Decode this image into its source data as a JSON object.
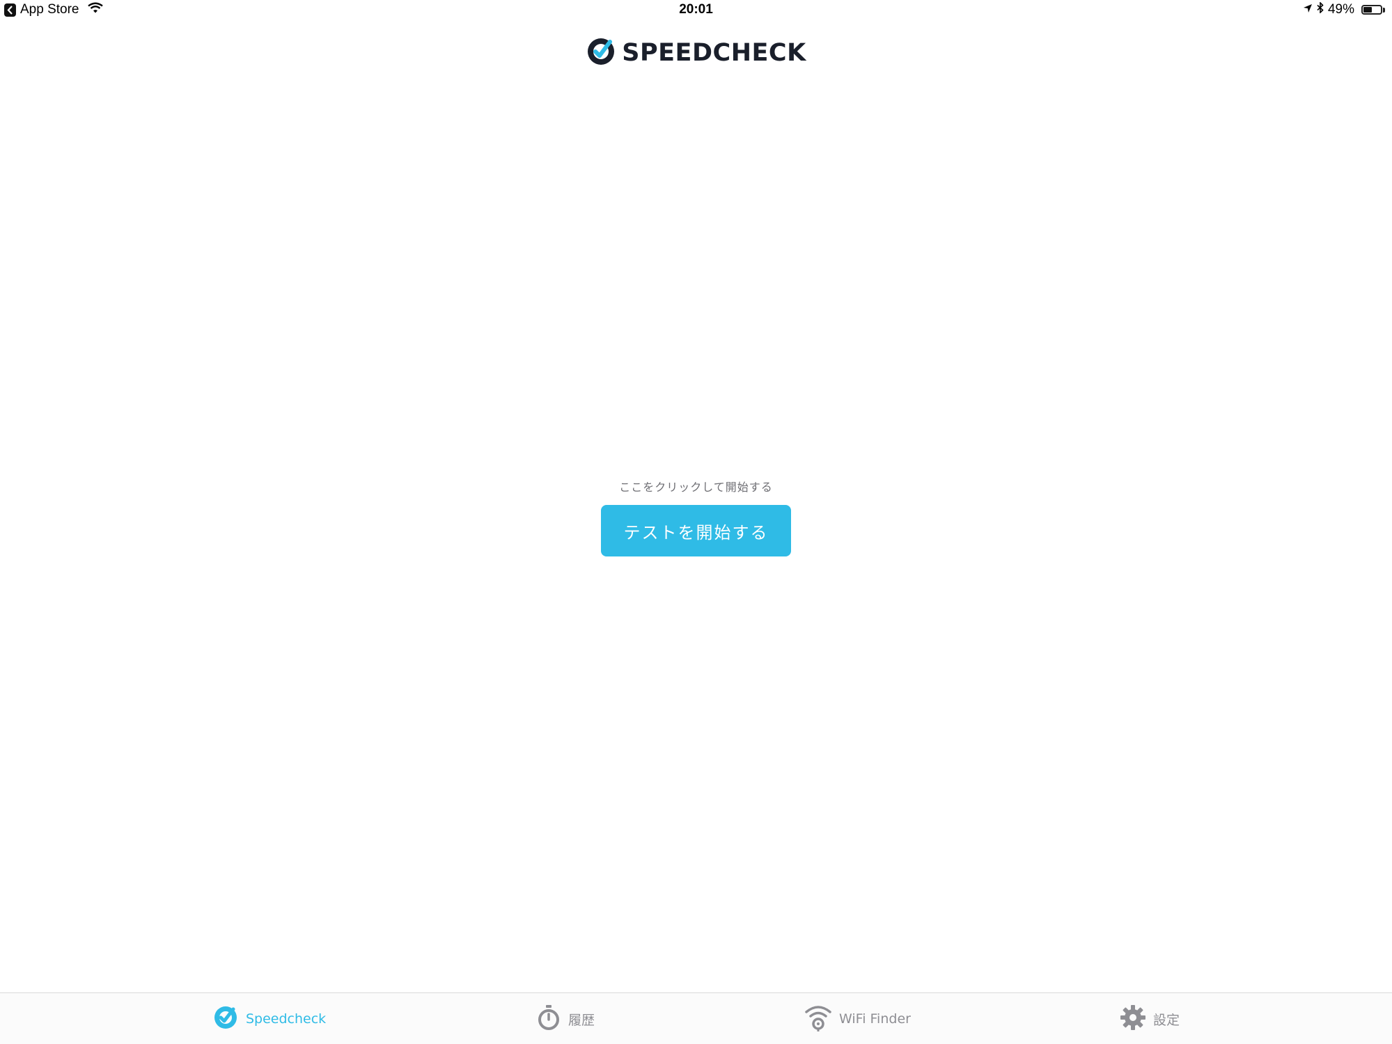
{
  "status_bar": {
    "back_app": "App Store",
    "time": "20:01",
    "battery_percent_label": "49%",
    "battery_level": 0.49
  },
  "header": {
    "logo_text": "SPEEDCHECK",
    "brand_color": "#2fbbe6",
    "dark_color": "#1a1f2b"
  },
  "main": {
    "hint": "ここをクリックして開始する",
    "start_button_label": "テストを開始する"
  },
  "tabs": [
    {
      "label": "Speedcheck",
      "icon": "speedcheck-icon",
      "active": true
    },
    {
      "label": "履歴",
      "icon": "stopwatch-icon",
      "active": false
    },
    {
      "label": "WiFi Finder",
      "icon": "wifi-finder-icon",
      "active": false
    },
    {
      "label": "設定",
      "icon": "gear-icon",
      "active": false
    }
  ]
}
